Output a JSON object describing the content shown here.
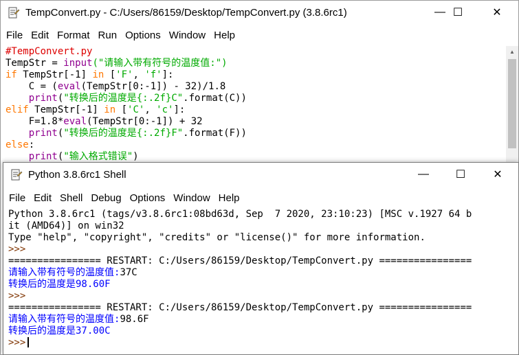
{
  "editor": {
    "title": "TempConvert.py - C:/Users/86159/Desktop/TempConvert.py (3.8.6rc1)",
    "menu": [
      "File",
      "Edit",
      "Format",
      "Run",
      "Options",
      "Window",
      "Help"
    ],
    "controls": {
      "minimize": "—",
      "maximize": "☐",
      "close": "✕"
    },
    "code": {
      "l1": "#TempConvert.py",
      "l2a": "TempStr = ",
      "l2b": "input",
      "l2c": "(\"请输入带有符号的温度值:\")",
      "l3a": "if",
      "l3b": " TempStr[-1] ",
      "l3c": "in",
      "l3d": " [",
      "l3e": "'F'",
      "l3f": ", ",
      "l3g": "'f'",
      "l3h": "]:",
      "l4a": "    C = (",
      "l4b": "eval",
      "l4c": "(TempStr[0:-1]) - 32)/1.8",
      "l5a": "    ",
      "l5b": "print",
      "l5c": "(",
      "l5d": "\"转换后的温度是{:.2f}C\"",
      "l5e": ".format(C))",
      "l6a": "elif",
      "l6b": " TempStr[-1] ",
      "l6c": "in",
      "l6d": " [",
      "l6e": "'C'",
      "l6f": ", ",
      "l6g": "'c'",
      "l6h": "]:",
      "l7a": "    F=1.8*",
      "l7b": "eval",
      "l7c": "(TempStr[0:-1]) + 32",
      "l8a": "    ",
      "l8b": "print",
      "l8c": "(",
      "l8d": "\"转换后的温度是{:.2f}F\"",
      "l8e": ".format(F))",
      "l9a": "else",
      "l9b": ":",
      "l10a": "    ",
      "l10b": "print",
      "l10c": "(",
      "l10d": "\"输入格式错误\"",
      "l10e": ")"
    }
  },
  "shell": {
    "title": "Python 3.8.6rc1 Shell",
    "menu": [
      "File",
      "Edit",
      "Shell",
      "Debug",
      "Options",
      "Window",
      "Help"
    ],
    "controls": {
      "minimize": "—",
      "maximize": "☐",
      "close": "✕"
    },
    "output": {
      "l1": "Python 3.8.6rc1 (tags/v3.8.6rc1:08bd63d, Sep  7 2020, 23:10:23) [MSC v.1927 64 b",
      "l2": "it (AMD64)] on win32",
      "l3": "Type \"help\", \"copyright\", \"credits\" or \"license()\" for more information.",
      "prompt": ">>>",
      "restart": "================ RESTART: C:/Users/86159/Desktop/TempConvert.py ================",
      "ask1": "请输入带有符号的温度值:",
      "in1": "37C",
      "res1": "转换后的温度是98.60F",
      "ask2": "请输入带有符号的温度值:",
      "in2": "98.6F",
      "res2": "转换后的温度是37.00C"
    }
  },
  "colors": {
    "keyword": "#ff7700",
    "builtin": "#900090",
    "string": "#00aa00",
    "comment": "#dd0000",
    "stdout": "#0000ff",
    "prompt": "#7f3300"
  }
}
